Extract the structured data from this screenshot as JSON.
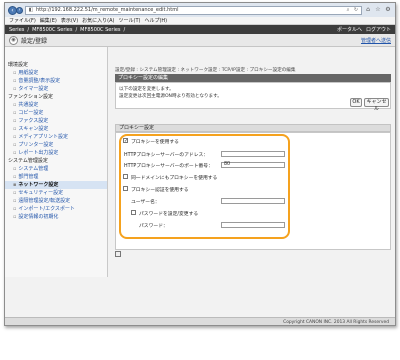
{
  "browser": {
    "url": "http://192.168.222.51/m_remote_maintenance_edit.html",
    "menu": [
      "ファイル(F)",
      "編集(E)",
      "表示(V)",
      "お気に入り(A)",
      "ツール(T)",
      "ヘルプ(H)"
    ]
  },
  "title_bar": {
    "brand": "Series",
    "model_a": "MF8500C Series",
    "model_b": "MF8500C Series",
    "portal": "ポータルへ",
    "logout": "ログアウト"
  },
  "header": {
    "title": "設定/登録",
    "admin_link": "管理者へ送信"
  },
  "sidebar": {
    "sections": [
      {
        "title": "環境設定",
        "items": [
          "用紙設定",
          "音量調整/表示設定",
          "タイマー設定"
        ]
      },
      {
        "title": "ファンクション設定",
        "items": [
          "共通設定",
          "コピー設定",
          "ファクス設定",
          "スキャン設定",
          "メディアプリント設定",
          "プリンター設定",
          "レポート出力設定"
        ]
      },
      {
        "title": "システム管理設定",
        "items": [
          "システム管理",
          "部門管理",
          "ネットワーク設定",
          "セキュリティー設定",
          "遠隔管理設定/転送設定",
          "インポート/エクスポート",
          "設定情報の初期化"
        ]
      }
    ],
    "active": "ネットワーク設定"
  },
  "main": {
    "breadcrumb": "設定/登録 : システム管理設定 : ネットワーク設定 : TCP/IP設定 : プロキシー設定の編集",
    "section_title": "プロキシー設定の編集",
    "info_line1": "以下の設定を変更します。",
    "info_line2": "設定変更は次回主電源ON時より有効となります。",
    "ok_label": "OK",
    "cancel_label": "キャンセル",
    "proxy_title": "プロキシー設定",
    "use_proxy_label": "プロキシーを使用する",
    "use_proxy_checked": true,
    "http_addr_label": "HTTPプロキシーサーバーのアドレス：",
    "http_addr_value": "",
    "http_port_label": "HTTPプロキシーサーバーのポート番号：",
    "http_port_value": "80",
    "same_domain_label": "同一ドメインにもプロキシーを使用する",
    "same_domain_checked": false,
    "auth_label": "プロキシー認証を使用する",
    "auth_checked": false,
    "username_label": "ユーザー名：",
    "username_value": "",
    "set_password_label": "パスワードを設定/変更する",
    "set_password_checked": false,
    "password_label": "パスワード：",
    "password_value": ""
  },
  "footer": {
    "copyright": "Copyright CANON INC. 2013 All Rights Reserved"
  }
}
